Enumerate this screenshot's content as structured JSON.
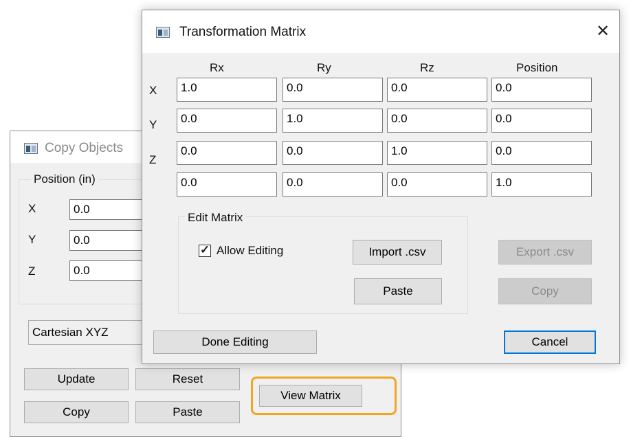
{
  "copy_objects": {
    "title": "Copy Objects",
    "position_group": "Position (in)",
    "fields": [
      {
        "label": "X",
        "value": "0.0"
      },
      {
        "label": "Y",
        "value": "0.0"
      },
      {
        "label": "Z",
        "value": "0.0"
      }
    ],
    "coordinate_system": "Cartesian XYZ",
    "buttons": {
      "update": "Update",
      "reset": "Reset",
      "copy": "Copy",
      "paste": "Paste",
      "view_matrix": "View Matrix"
    }
  },
  "transformation_matrix": {
    "title": "Transformation Matrix",
    "close_glyph": "✕",
    "columns": [
      "Rx",
      "Ry",
      "Rz",
      "Position"
    ],
    "row_labels": [
      "X",
      "Y",
      "Z",
      ""
    ],
    "rows": [
      [
        "1.0",
        "0.0",
        "0.0",
        "0.0"
      ],
      [
        "0.0",
        "1.0",
        "0.0",
        "0.0"
      ],
      [
        "0.0",
        "0.0",
        "1.0",
        "0.0"
      ],
      [
        "0.0",
        "0.0",
        "0.0",
        "1.0"
      ]
    ],
    "edit_group": "Edit Matrix",
    "allow_editing": {
      "label": "Allow Editing",
      "checked": true,
      "glyph": "✓"
    },
    "buttons": {
      "import_csv": "Import .csv",
      "paste": "Paste",
      "export_csv": "Export .csv",
      "copy": "Copy",
      "done_editing": "Done Editing",
      "cancel": "Cancel"
    }
  },
  "colors": {
    "highlight": "#f0a620",
    "dialog_bg": "#f0f0f0",
    "focus_border": "#0078d7",
    "disabled_text": "#8a8a8a"
  }
}
